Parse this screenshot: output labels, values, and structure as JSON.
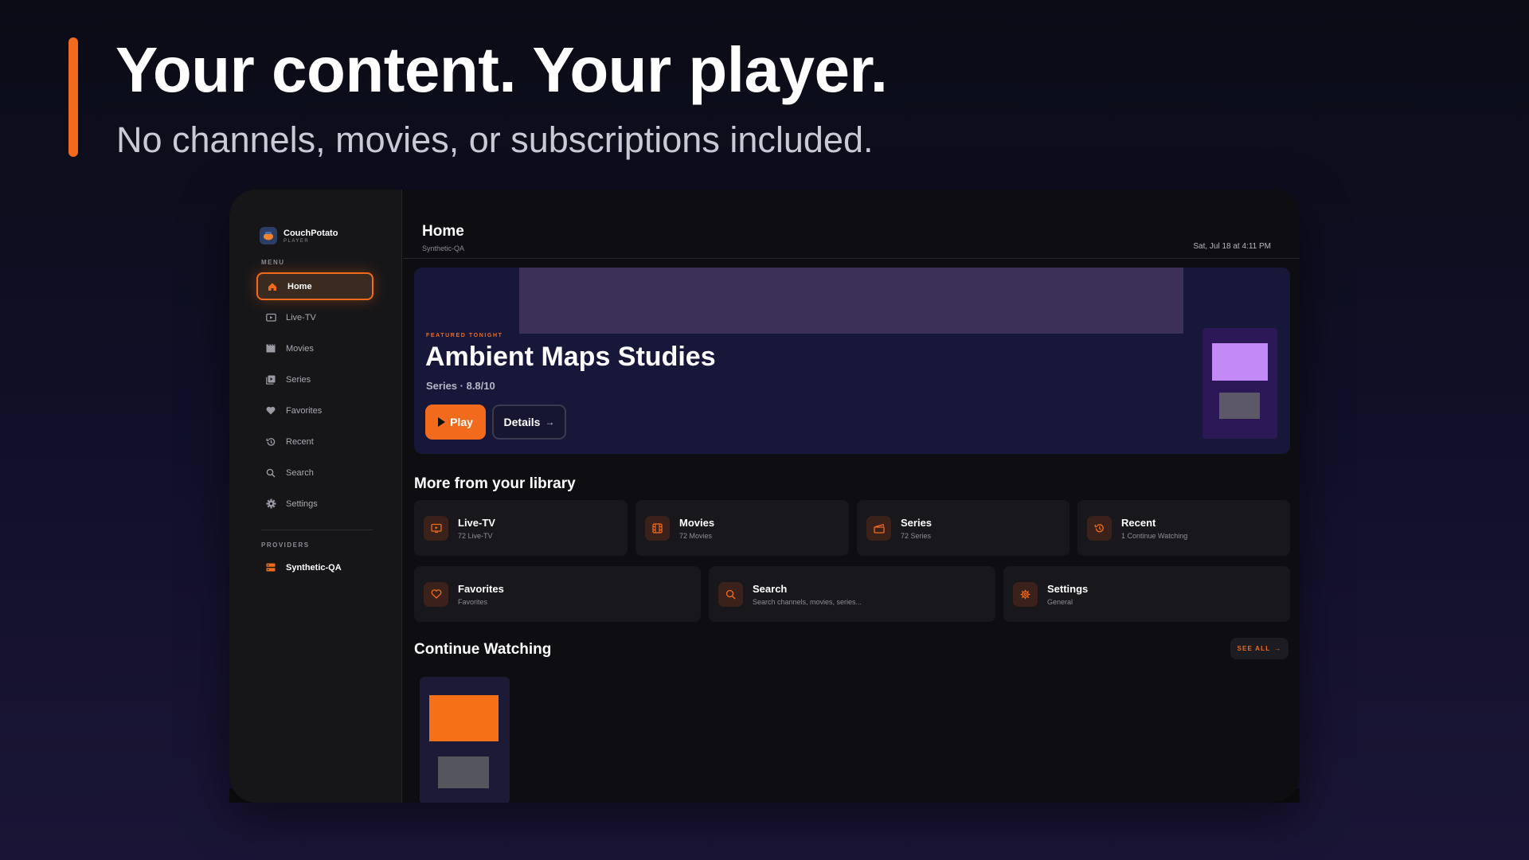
{
  "promo": {
    "headline": "Your content. Your player.",
    "subline": "No channels, movies, or subscriptions included."
  },
  "colors": {
    "accent": "#f26b1d",
    "background": "#0e0e12",
    "sidebar": "#161619"
  },
  "app": {
    "brand_name": "CouchPotato",
    "brand_sub": "PLAYER",
    "menu_label": "MENU",
    "providers_label": "PROVIDERS",
    "nav": [
      {
        "label": "Home",
        "icon": "home-icon",
        "active": true
      },
      {
        "label": "Live-TV",
        "icon": "tv-icon"
      },
      {
        "label": "Movies",
        "icon": "film-icon"
      },
      {
        "label": "Series",
        "icon": "series-icon"
      },
      {
        "label": "Favorites",
        "icon": "heart-icon"
      },
      {
        "label": "Recent",
        "icon": "history-icon"
      },
      {
        "label": "Search",
        "icon": "search-icon"
      },
      {
        "label": "Settings",
        "icon": "gear-icon"
      }
    ],
    "provider": {
      "label": "Synthetic-QA",
      "icon": "server-icon"
    }
  },
  "header": {
    "title": "Home",
    "subtitle": "Synthetic-QA",
    "datetime": "Sat, Jul 18 at 4:11 PM"
  },
  "hero": {
    "tag": "FEATURED TONIGHT",
    "title": "Ambient Maps Studies",
    "meta": "Series · 8.8/10",
    "play_label": "Play",
    "details_label": "Details"
  },
  "library": {
    "title": "More from your library",
    "tiles": [
      {
        "name": "Live-TV",
        "sub": "72 Live-TV",
        "icon": "tv-icon"
      },
      {
        "name": "Movies",
        "sub": "72 Movies",
        "icon": "film-icon"
      },
      {
        "name": "Series",
        "sub": "72 Series",
        "icon": "clapper-icon"
      },
      {
        "name": "Recent",
        "sub": "1 Continue Watching",
        "icon": "history-icon"
      },
      {
        "name": "Favorites",
        "sub": "Favorites",
        "icon": "heart-icon"
      },
      {
        "name": "Search",
        "sub": "Search channels, movies, series...",
        "icon": "search-icon"
      },
      {
        "name": "Settings",
        "sub": "General",
        "icon": "gear-icon"
      }
    ]
  },
  "continue_watching": {
    "title": "Continue Watching",
    "see_all_label": "SEE ALL"
  }
}
